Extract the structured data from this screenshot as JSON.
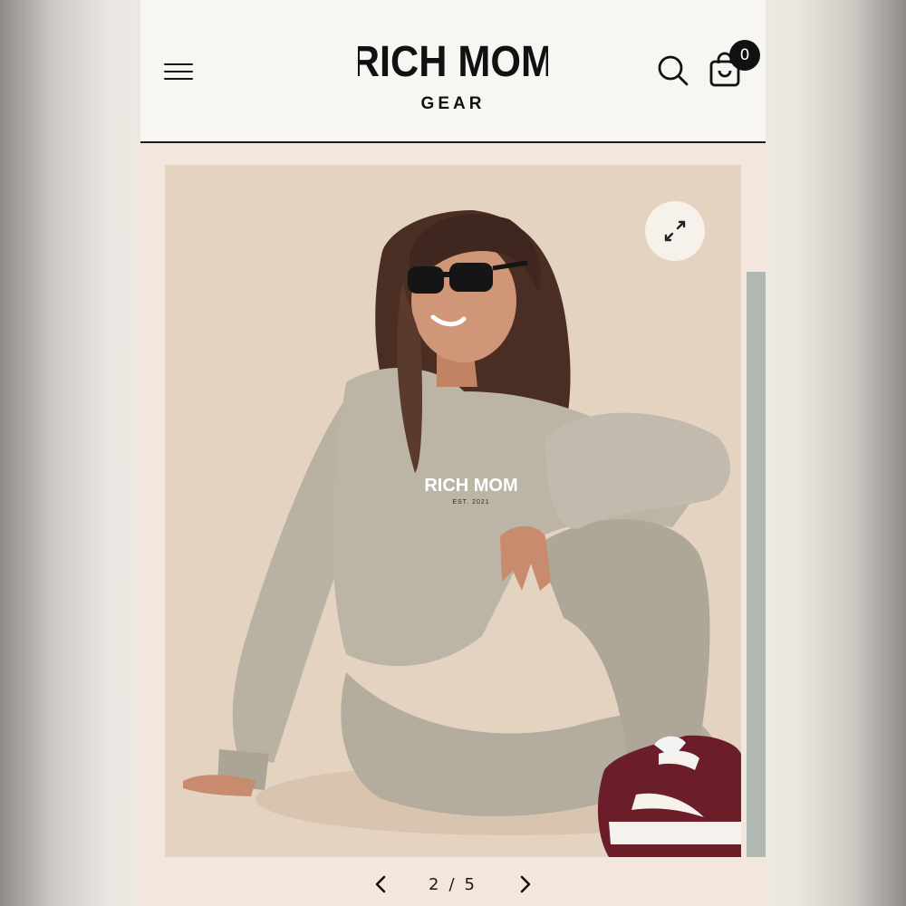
{
  "brand": {
    "name_line1": "RICH MOM",
    "name_line2": "GEAR"
  },
  "header": {
    "menu_icon": "hamburger-menu-icon",
    "search_icon": "search-icon",
    "cart_icon": "shopping-bag-icon",
    "cart_count": "0"
  },
  "gallery": {
    "expand_icon": "expand-icon",
    "current": "2",
    "separator": "/",
    "total": "5",
    "prev_icon": "chevron-left-icon",
    "next_icon": "chevron-right-icon"
  },
  "product_print": {
    "line1": "RICH MOM",
    "line2": "EST. 2021"
  },
  "colors": {
    "header_bg": "#f8f6f2",
    "page_bg": "#f3e7dd",
    "photo_bg": "#e5d3c2",
    "garment": "#b9b2a3",
    "sneaker": "#6b1e2a"
  }
}
